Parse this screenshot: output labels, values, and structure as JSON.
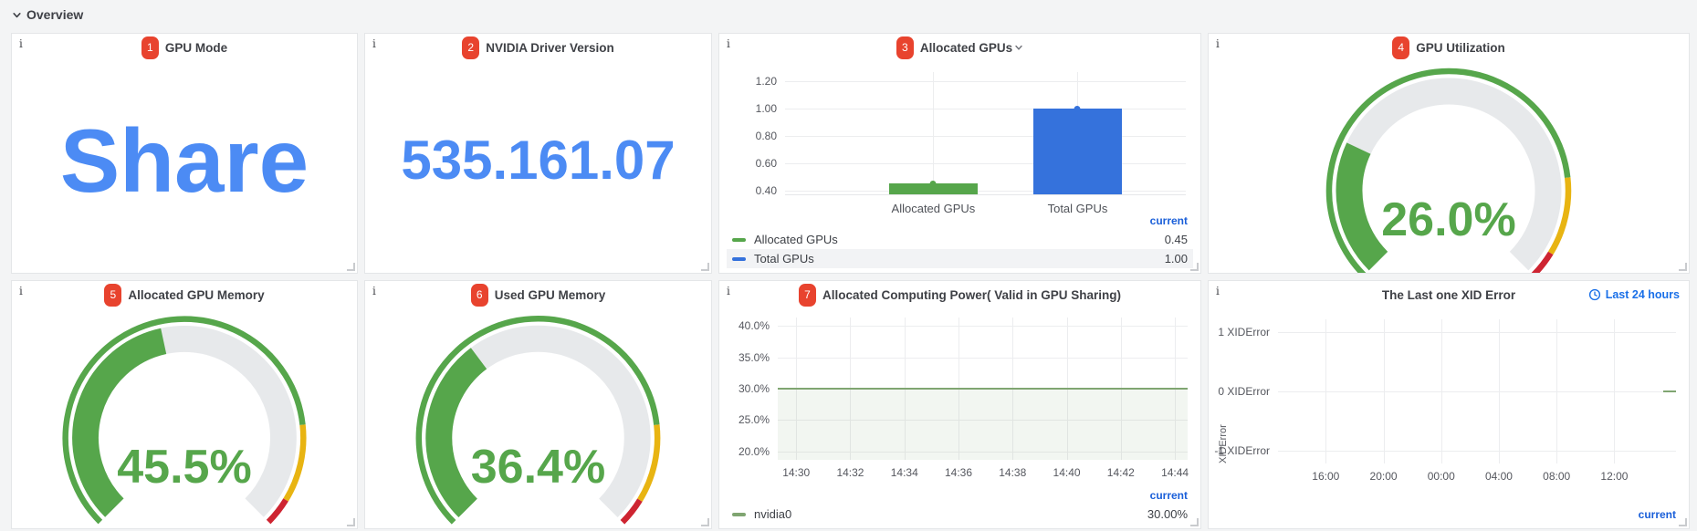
{
  "page": {
    "section_title": "Overview"
  },
  "colors": {
    "stat_blue": "#4C8BF4",
    "bar_blue": "#3572DC",
    "green": "#56A64B",
    "muted_line_green": "#7FA571",
    "threshold_yellow": "#E8B412",
    "threshold_red": "#CE2431",
    "badge_red": "#E8432E",
    "link_blue": "#1A70E8",
    "legend_current_blue": "#1A5FD9"
  },
  "gauge": {
    "thresholds": [
      0.81,
      0.95
    ]
  },
  "panels": {
    "gpu_mode": {
      "badge": "1",
      "title": "GPU Mode",
      "value": "Share"
    },
    "nvidia_driver_version": {
      "badge": "2",
      "title": "NVIDIA Driver Version",
      "value": "535.161.07"
    },
    "allocated_gpus": {
      "badge": "3",
      "title": "Allocated GPUs",
      "chart_data": {
        "type": "bar",
        "categories": [
          "Allocated GPUs",
          "Total GPUs"
        ],
        "values": [
          0.45,
          1.0
        ],
        "series_colors": [
          "#56A64B",
          "#3572DC"
        ],
        "yticks": [
          "1.20",
          "1.00",
          "0.80",
          "0.60",
          "0.40"
        ],
        "ylim": [
          0.37,
          1.27
        ],
        "grid": true,
        "legend_position": "bottom"
      },
      "legend": {
        "header": "current",
        "rows": [
          {
            "label": "Allocated GPUs",
            "value": "0.45"
          },
          {
            "label": "Total GPUs",
            "value": "1.00"
          }
        ]
      }
    },
    "gpu_utilization": {
      "badge": "4",
      "title": "GPU Utilization",
      "value": "26.0%",
      "fraction": 0.26
    },
    "allocated_gpu_memory": {
      "badge": "5",
      "title": "Allocated GPU Memory",
      "value": "45.5%",
      "fraction": 0.455
    },
    "used_gpu_memory": {
      "badge": "6",
      "title": "Used GPU Memory",
      "value": "36.4%",
      "fraction": 0.364
    },
    "allocated_computing_power": {
      "badge": "7",
      "title": "Allocated Computing Power( Valid in GPU Sharing)",
      "chart_data": {
        "type": "line",
        "x": [
          "14:30",
          "14:32",
          "14:34",
          "14:36",
          "14:38",
          "14:40",
          "14:42",
          "14:44"
        ],
        "series": [
          {
            "name": "nvidia0",
            "values": [
              30,
              30,
              30,
              30,
              30,
              30,
              30,
              30
            ]
          }
        ],
        "yticks": [
          "40.0%",
          "35.0%",
          "30.0%",
          "25.0%",
          "20.0%"
        ],
        "ylim": [
          19,
          41.5
        ],
        "fill": true,
        "grid": true,
        "legend_position": "bottom"
      },
      "legend": {
        "header": "current",
        "rows": [
          {
            "label": "nvidia0",
            "value": "30.00%"
          }
        ]
      }
    },
    "xid_error": {
      "title": "The Last one XID Error",
      "time_range_label": "Last 24 hours",
      "chart_data": {
        "type": "line",
        "ylabel": "XIDError",
        "yticks": [
          "1 XIDError",
          "0 XIDError",
          "-1 XIDError"
        ],
        "xticks": [
          "16:00",
          "20:00",
          "00:00",
          "04:00",
          "08:00",
          "12:00"
        ],
        "current_segment_value": 0,
        "grid": true
      },
      "legend_header": "current"
    }
  }
}
